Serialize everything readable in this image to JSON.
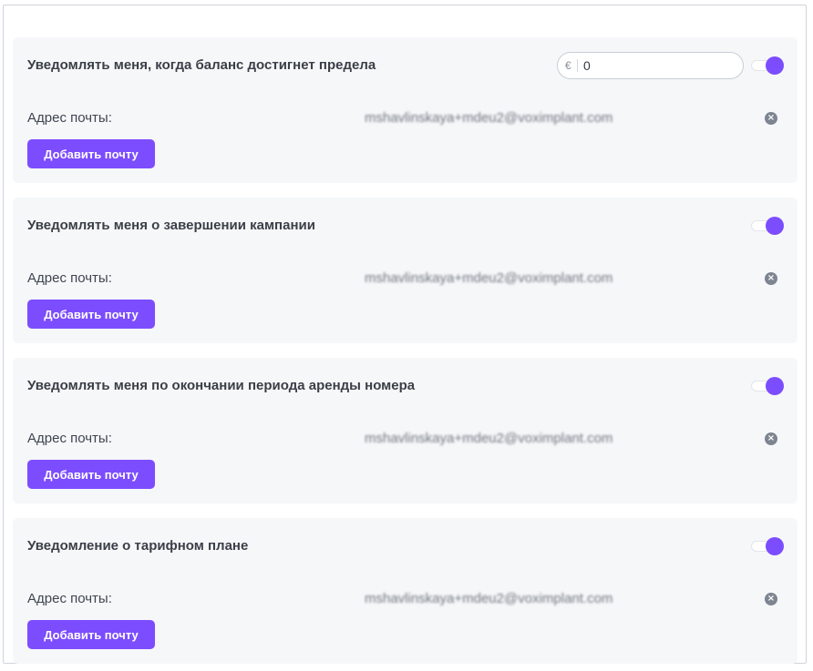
{
  "accent_color": "#7c4dff",
  "cards": [
    {
      "title": "Уведомлять меня, когда баланс достигнет предела",
      "toggle_on": true,
      "has_balance_field": true,
      "balance": {
        "currency": "€",
        "value": "0"
      },
      "email_label": "Адрес почты:",
      "email": "mshavlinskaya+mdeu2@voximplant.com",
      "remove_icon": "close-circle-icon",
      "add_button": "Добавить почту"
    },
    {
      "title": "Уведомлять меня о завершении кампании",
      "toggle_on": true,
      "email_label": "Адрес почты:",
      "email": "mshavlinskaya+mdeu2@voximplant.com",
      "remove_icon": "close-circle-icon",
      "add_button": "Добавить почту"
    },
    {
      "title": "Уведомлять меня по окончании периода аренды номера",
      "toggle_on": true,
      "email_label": "Адрес почты:",
      "email": "mshavlinskaya+mdeu2@voximplant.com",
      "remove_icon": "close-circle-icon",
      "add_button": "Добавить почту"
    },
    {
      "title": "Уведомление о тарифном плане",
      "toggle_on": true,
      "email_label": "Адрес почты:",
      "email": "mshavlinskaya+mdeu2@voximplant.com",
      "remove_icon": "close-circle-icon",
      "add_button": "Добавить почту"
    }
  ]
}
